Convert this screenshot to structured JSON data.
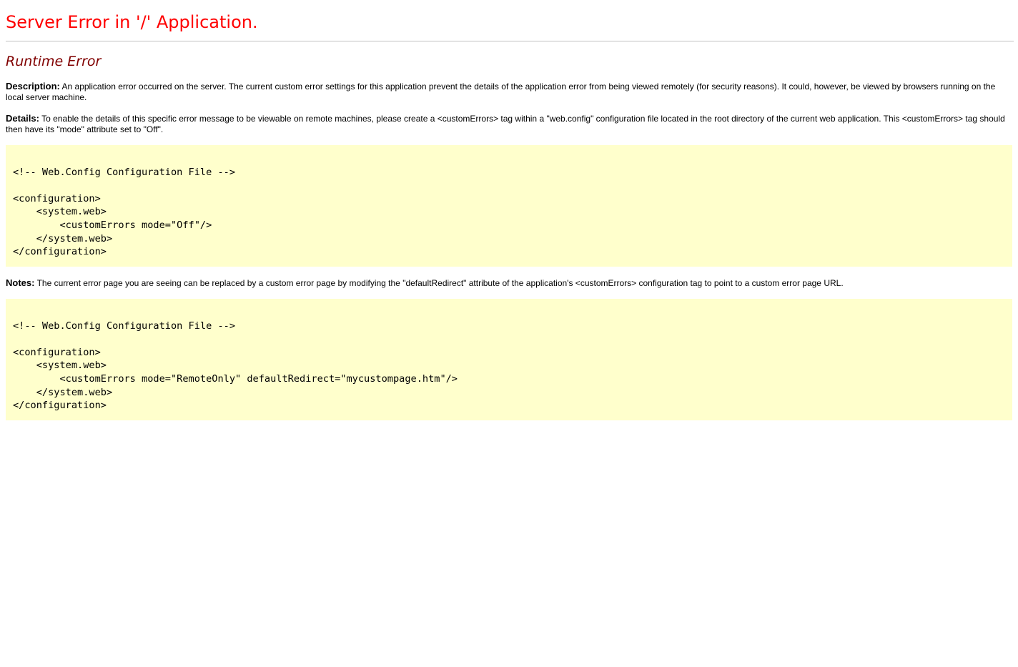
{
  "page": {
    "title": "Server Error in '/' Application.",
    "subtitle": "Runtime Error"
  },
  "description": {
    "label": "Description:",
    "text": " An application error occurred on the server. The current custom error settings for this application prevent the details of the application error from being viewed remotely (for security reasons). It could, however, be viewed by browsers running on the local server machine."
  },
  "details": {
    "label": "Details:",
    "text": " To enable the details of this specific error message to be viewable on remote machines, please create a <customErrors> tag within a \"web.config\" configuration file located in the root directory of the current web application. This <customErrors> tag should then have its \"mode\" attribute set to \"Off\"."
  },
  "code_block_1": {
    "text": "\n<!-- Web.Config Configuration File -->\n\n<configuration>\n    <system.web>\n        <customErrors mode=\"Off\"/>\n    </system.web>\n</configuration>"
  },
  "notes": {
    "label": "Notes:",
    "text": " The current error page you are seeing can be replaced by a custom error page by modifying the \"defaultRedirect\" attribute of the application's <customErrors> configuration tag to point to a custom error page URL."
  },
  "code_block_2": {
    "text": "\n<!-- Web.Config Configuration File -->\n\n<configuration>\n    <system.web>\n        <customErrors mode=\"RemoteOnly\" defaultRedirect=\"mycustompage.htm\"/>\n    </system.web>\n</configuration>"
  },
  "colors": {
    "title": "#ff0000",
    "subtitle": "#800000",
    "code_background": "#ffffcc",
    "rule": "#c0c0c0"
  }
}
